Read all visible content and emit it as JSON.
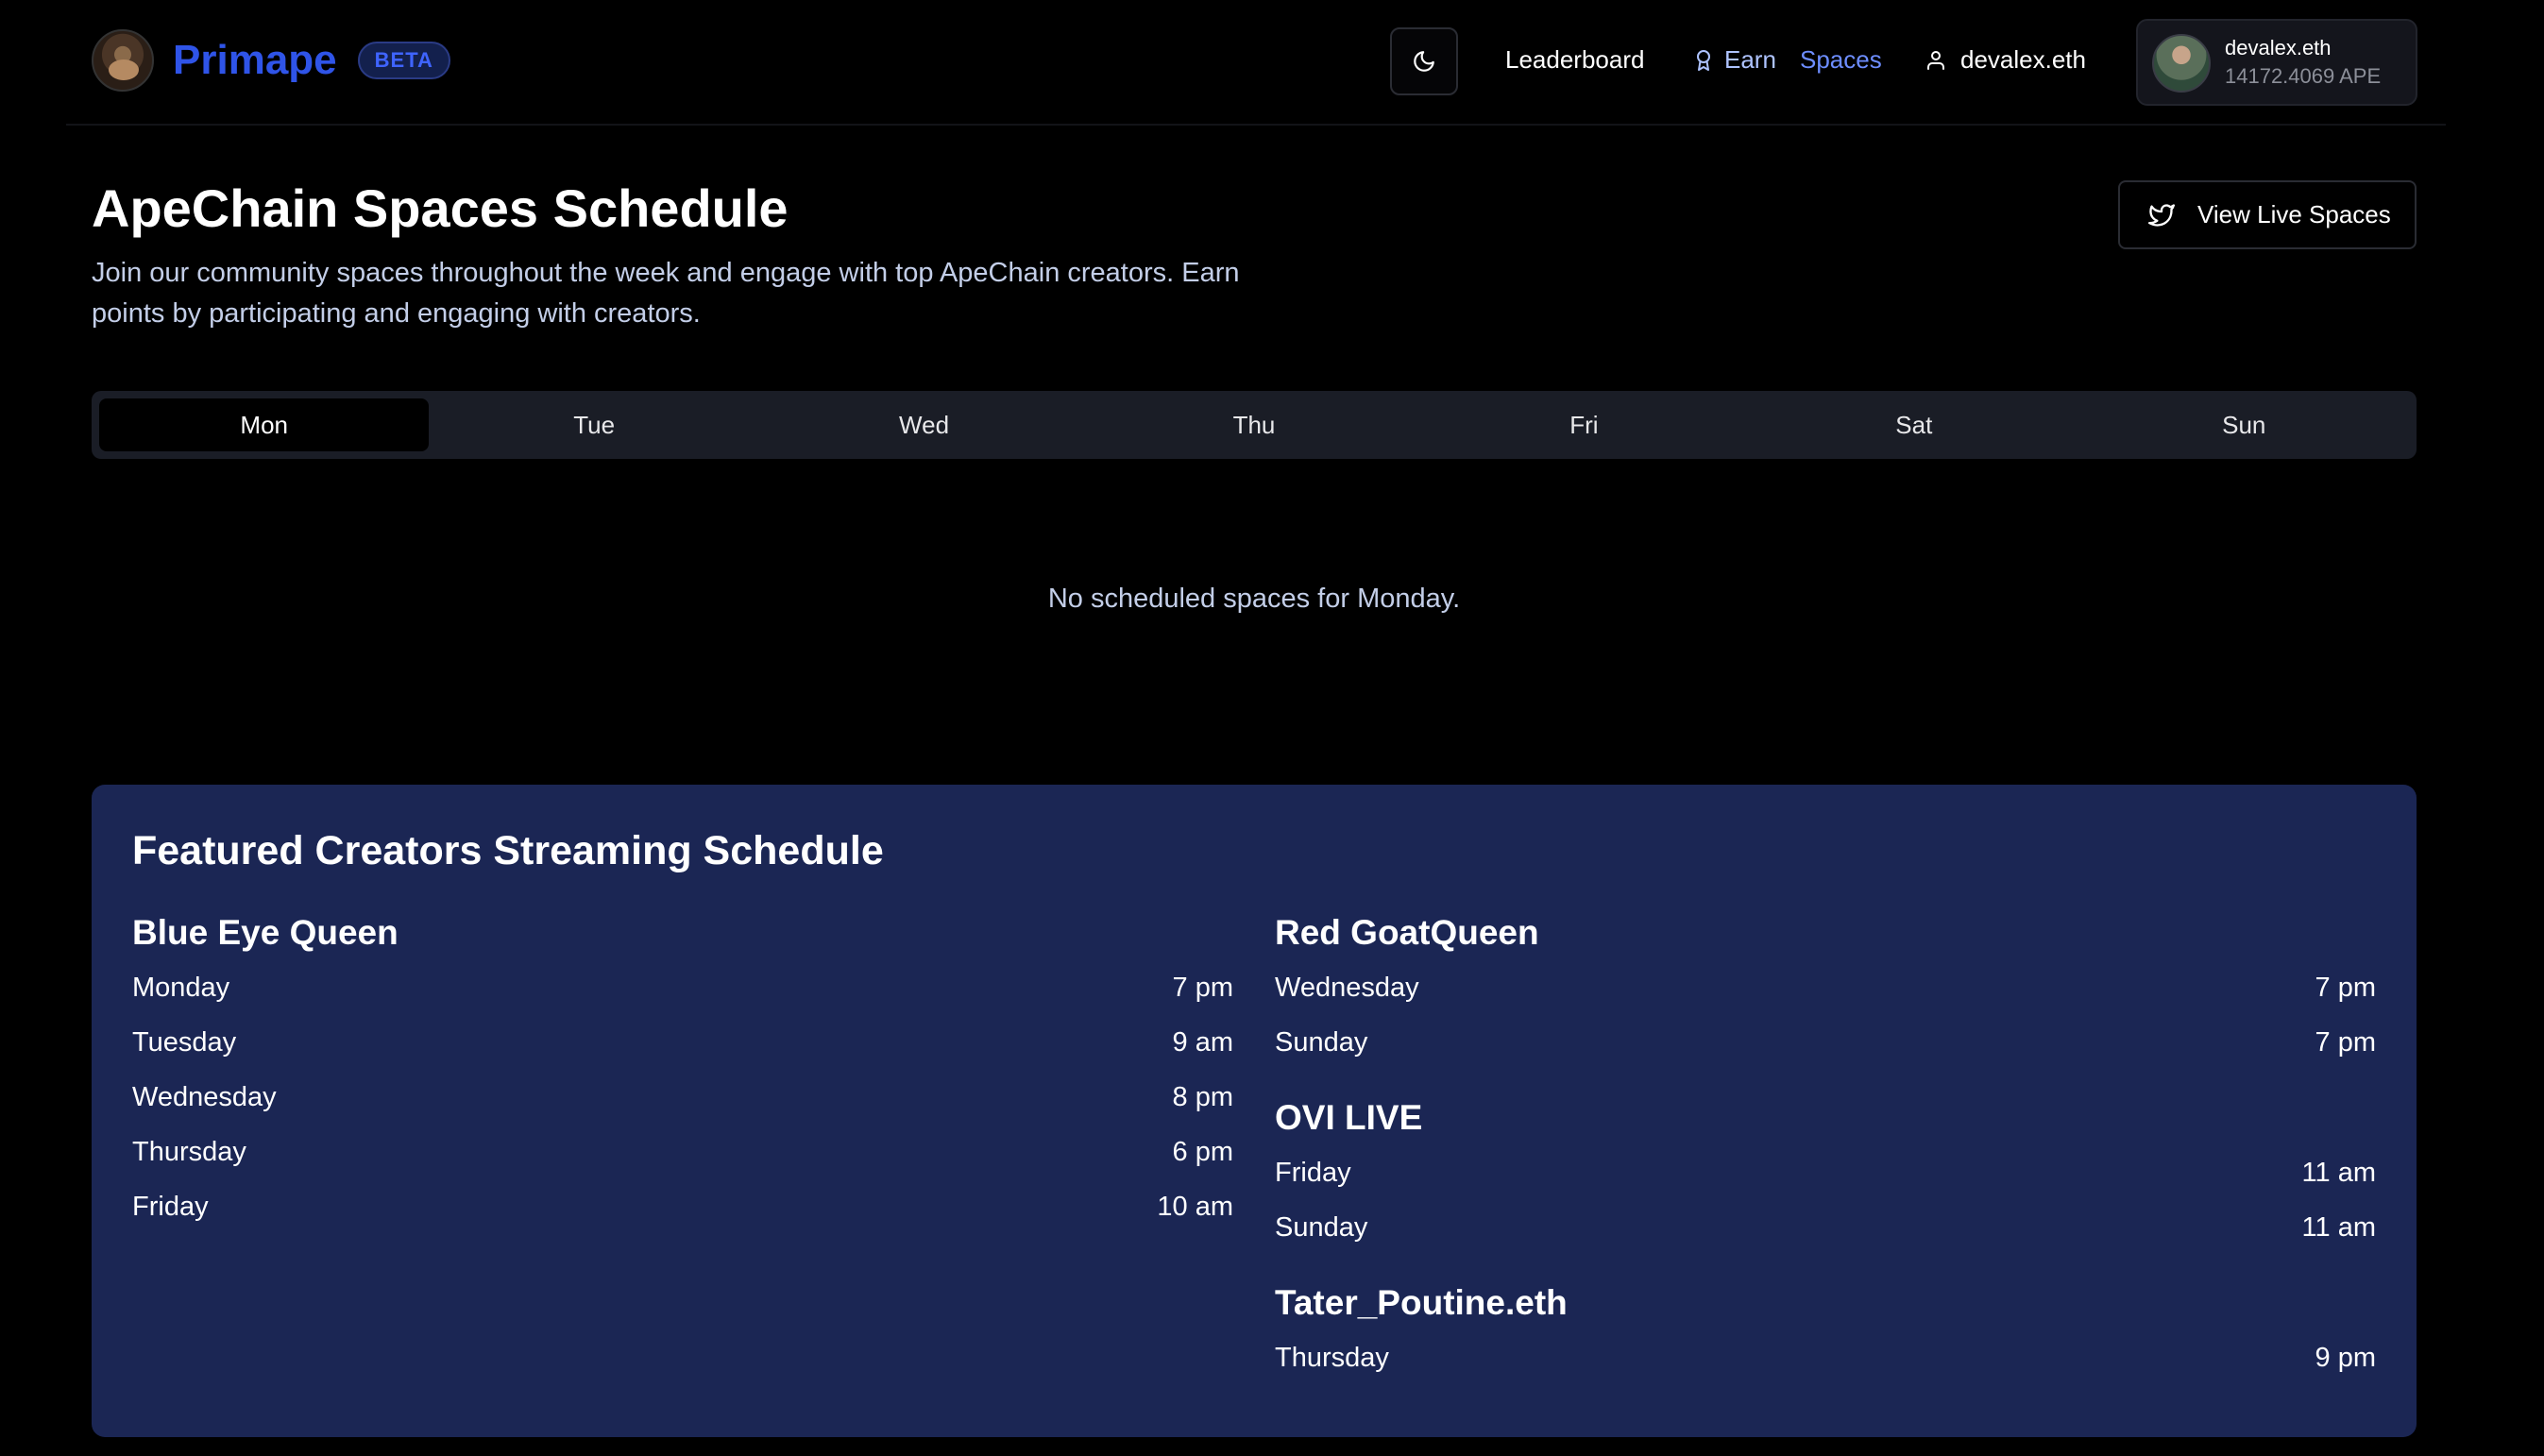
{
  "header": {
    "brand": "Primape",
    "beta": "BETA",
    "nav": {
      "leaderboard": "Leaderboard",
      "earn": "Earn",
      "spaces": "Spaces",
      "user": "devalex.eth"
    },
    "wallet": {
      "name": "devalex.eth",
      "balance": "14172.4069 APE"
    },
    "icons": {
      "theme": "moon-icon",
      "earn": "award-icon",
      "user": "user-icon",
      "live": "twitter-icon"
    }
  },
  "page": {
    "title": "ApeChain Spaces Schedule",
    "description": "Join our community spaces throughout the week and engage with top ApeChain creators. Earn points by participating and engaging with creators.",
    "view_live_label": "View Live Spaces"
  },
  "tabs": {
    "items": [
      "Mon",
      "Tue",
      "Wed",
      "Thu",
      "Fri",
      "Sat",
      "Sun"
    ],
    "active": "Mon"
  },
  "empty_message": "No scheduled spaces for Monday.",
  "featured": {
    "title": "Featured Creators Streaming Schedule",
    "left": [
      {
        "name": "Blue Eye Queen",
        "slots": [
          {
            "day": "Monday",
            "time": "7 pm"
          },
          {
            "day": "Tuesday",
            "time": "9 am"
          },
          {
            "day": "Wednesday",
            "time": "8 pm"
          },
          {
            "day": "Thursday",
            "time": "6 pm"
          },
          {
            "day": "Friday",
            "time": "10 am"
          }
        ]
      }
    ],
    "right": [
      {
        "name": "Red GoatQueen",
        "slots": [
          {
            "day": "Wednesday",
            "time": "7 pm"
          },
          {
            "day": "Sunday",
            "time": "7 pm"
          }
        ]
      },
      {
        "name": "OVI LIVE",
        "slots": [
          {
            "day": "Friday",
            "time": "11 am"
          },
          {
            "day": "Sunday",
            "time": "11 am"
          }
        ]
      },
      {
        "name": "Tater_Poutine.eth",
        "slots": [
          {
            "day": "Thursday",
            "time": "9 pm"
          }
        ]
      }
    ]
  },
  "colors": {
    "background": "#000000",
    "brand": "#2f54e8",
    "featured_bg": "#1b2654",
    "tabs_bg": "#1a1d26",
    "spaces_link": "#6d8dff"
  }
}
